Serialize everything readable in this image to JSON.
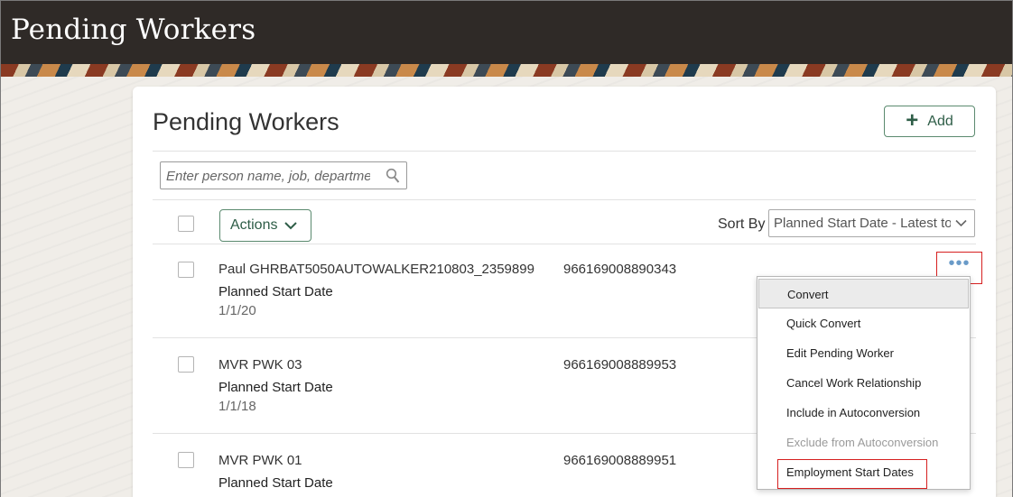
{
  "header": {
    "title": "Pending Workers"
  },
  "card": {
    "title": "Pending Workers",
    "add_label": "Add",
    "search_placeholder": "Enter person name, job, departme",
    "actions_label": "Actions",
    "sort_by_label": "Sort By",
    "sort_value": "Planned Start Date - Latest to"
  },
  "rows": [
    {
      "name": "Paul GHRBAT5050AUTOWALKER210803_2359899",
      "number": "966169008890343",
      "date_label": "Planned Start Date",
      "date": "1/1/20"
    },
    {
      "name": "MVR PWK 03",
      "number": "966169008889953",
      "date_label": "Planned Start Date",
      "date": "1/1/18"
    },
    {
      "name": "MVR PWK 01",
      "number": "966169008889951",
      "date_label": "Planned Start Date",
      "date": ""
    }
  ],
  "menu": {
    "items": [
      {
        "label": "Convert",
        "state": "hovered"
      },
      {
        "label": "Quick Convert",
        "state": "enabled"
      },
      {
        "label": "Edit Pending Worker",
        "state": "enabled"
      },
      {
        "label": "Cancel Work Relationship",
        "state": "enabled"
      },
      {
        "label": "Include in Autoconversion",
        "state": "enabled"
      },
      {
        "label": "Exclude from Autoconversion",
        "state": "disabled"
      },
      {
        "label": "Employment Start Dates",
        "state": "enabled"
      }
    ]
  },
  "colors": {
    "header_bg": "#2f2a27",
    "accent_green": "#2e5d47",
    "highlight_red": "#d62020",
    "ellipsis_blue": "#6a9bc8"
  }
}
